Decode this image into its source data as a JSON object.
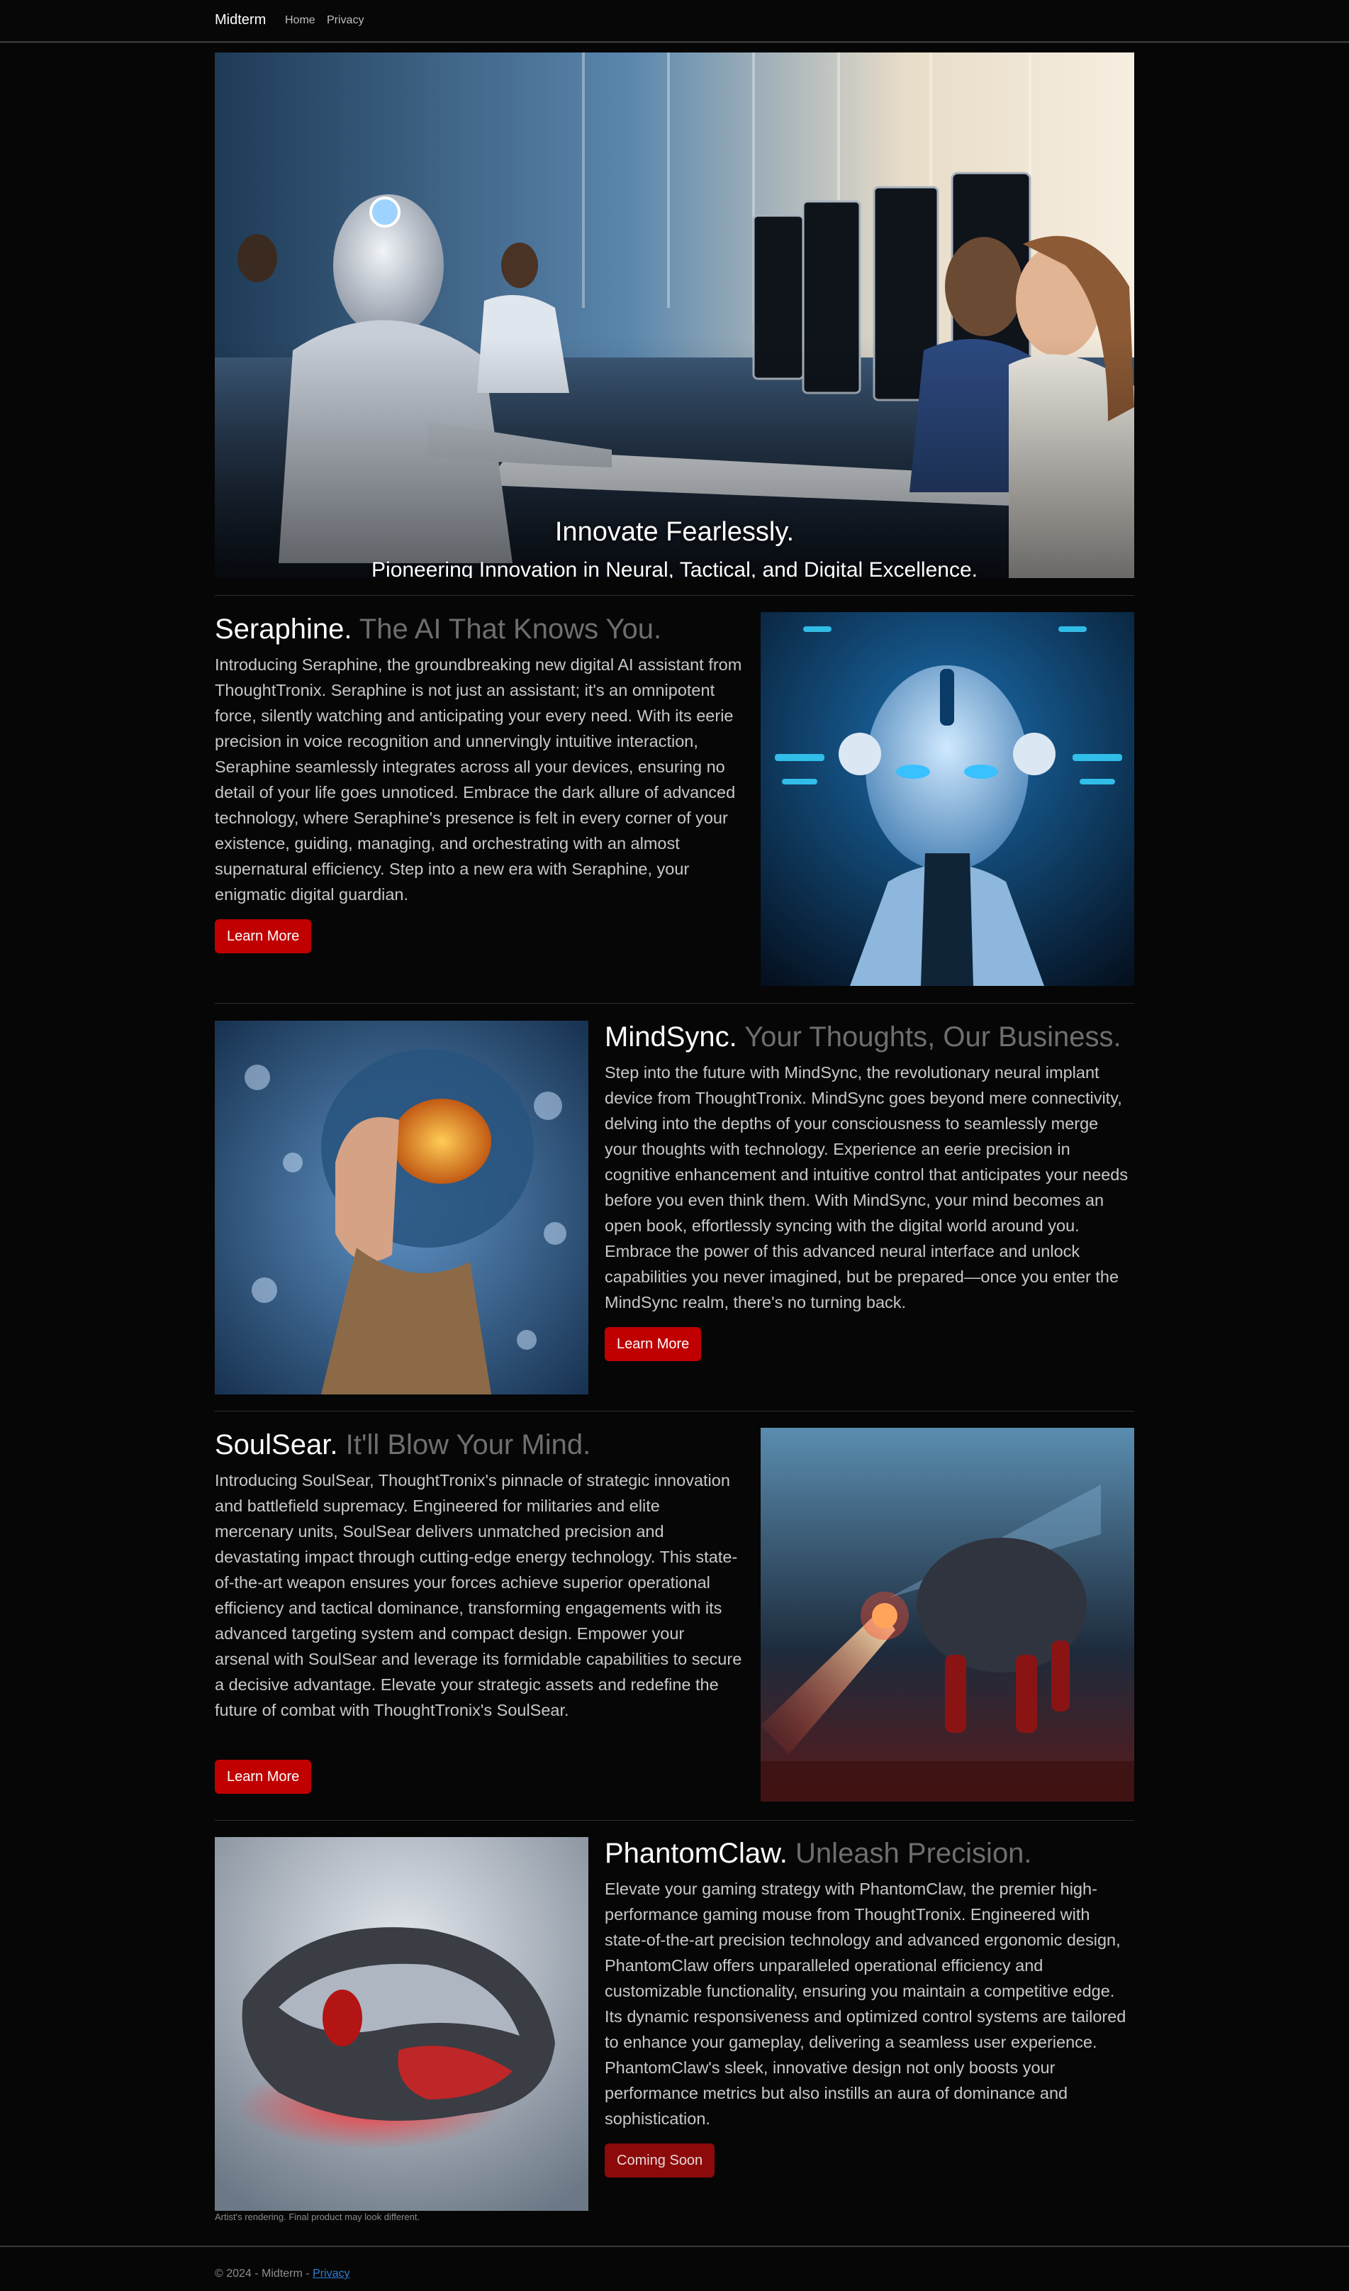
{
  "nav": {
    "brand": "Midterm",
    "links": [
      "Home",
      "Privacy"
    ]
  },
  "hero": {
    "title": "Innovate Fearlessly.",
    "subtitle": "Pioneering Innovation in Neural, Tactical, and Digital Excellence."
  },
  "features": [
    {
      "name": "Seraphine.",
      "tagline": "The AI That Knows You.",
      "text": "Introducing Seraphine, the groundbreaking new digital AI assistant from ThoughtTronix. Seraphine is not just an assistant; it's an omnipotent force, silently watching and anticipating your every need. With its eerie precision in voice recognition and unnervingly intuitive interaction, Seraphine seamlessly integrates across all your devices, ensuring no detail of your life goes unnoticed. Embrace the dark allure of advanced technology, where Seraphine's presence is felt in every corner of your existence, guiding, managing, and orchestrating with an almost supernatural efficiency. Step into a new era with Seraphine, your enigmatic digital guardian.",
      "button": "Learn More"
    },
    {
      "name": "MindSync.",
      "tagline": "Your Thoughts, Our Business.",
      "text": "Step into the future with MindSync, the revolutionary neural implant device from ThoughtTronix. MindSync goes beyond mere connectivity, delving into the depths of your consciousness to seamlessly merge your thoughts with technology. Experience an eerie precision in cognitive enhancement and intuitive control that anticipates your needs before you even think them. With MindSync, your mind becomes an open book, effortlessly syncing with the digital world around you. Embrace the power of this advanced neural interface and unlock capabilities you never imagined, but be prepared—once you enter the MindSync realm, there's no turning back.",
      "button": "Learn More"
    },
    {
      "name": "SoulSear.",
      "tagline": "It'll Blow Your Mind.",
      "text": "Introducing SoulSear, ThoughtTronix's pinnacle of strategic innovation and battlefield supremacy. Engineered for militaries and elite mercenary units, SoulSear delivers unmatched precision and devastating impact through cutting-edge energy technology. This state-of-the-art weapon ensures your forces achieve superior operational efficiency and tactical dominance, transforming engagements with its advanced targeting system and compact design. Empower your arsenal with SoulSear and leverage its formidable capabilities to secure a decisive advantage. Elevate your strategic assets and redefine the future of combat with ThoughtTronix's SoulSear.",
      "button": "Learn More"
    },
    {
      "name": "PhantomClaw.",
      "tagline": "Unleash Precision.",
      "text": "Elevate your gaming strategy with PhantomClaw, the premier high-performance gaming mouse from ThoughtTronix. Engineered with state-of-the-art precision technology and advanced ergonomic design, PhantomClaw offers unparalleled operational efficiency and customizable functionality, ensuring you maintain a competitive edge. Its dynamic responsiveness and optimized control systems are tailored to enhance your gameplay, delivering a seamless user experience. PhantomClaw's sleek, innovative design not only boosts your performance metrics but also instills an aura of dominance and sophistication.",
      "button": "Coming Soon",
      "note": "Artist's rendering. Final product may look different."
    }
  ],
  "footer": {
    "copyright": "© 2024 - Midterm - ",
    "privacy_link": "Privacy"
  },
  "colors": {
    "background": "#060606",
    "accent_button": "#c00000",
    "link": "#2f7fd6",
    "muted_heading": "#6e6e6e"
  }
}
